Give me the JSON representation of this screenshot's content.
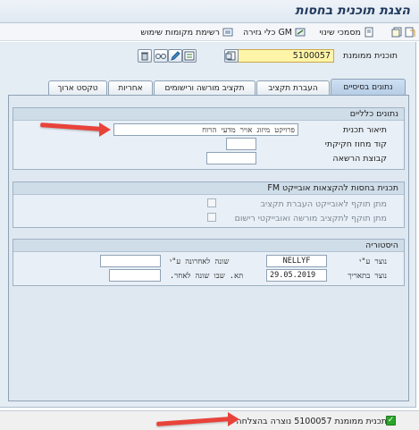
{
  "window": {
    "title": "הצגת תוכנית בחסות"
  },
  "toolbar": {
    "where_used_list": "רשימת מקומות שימוש",
    "gm_derivation_tools": "GM כלי גזירה",
    "usage_docs": "מסמכי שינוי"
  },
  "header": {
    "budget_label": "תוכנית ממומנת",
    "budget_value": "5100057"
  },
  "tabs": [
    {
      "label": "נתונים בסיסיים",
      "active": true
    },
    {
      "label": "העברת תקציב",
      "active": false
    },
    {
      "label": "תקציב מורשה ורישומים",
      "active": false
    },
    {
      "label": "אחריות",
      "active": false
    },
    {
      "label": "טקסט ארוך",
      "active": false
    }
  ],
  "general_data": {
    "title": "נתונים כלליים",
    "description_label": "תיאור תכנית",
    "description_value": "פרויקט מיזוג אויר מדעי הרוח",
    "funding_code_label": "קוד מחוז חקיקתי",
    "funding_code_value": "",
    "auth_group_label": "קבוצת הרשאה",
    "auth_group_value": ""
  },
  "fm_assignment": {
    "title": "תכנית בחסות להקצאות אובייקט FM",
    "transfer_object_label": "מתן תוקף לאובייקט העברת תקציב",
    "posting_object_label": "מתן תוקף לתקציב מורשה ואובייקטי רישום",
    "transfer_object_checked": false,
    "posting_object_checked": false
  },
  "history": {
    "title": "היסטוריה",
    "created_by_label": "נוצר ע\"י",
    "created_by_value": "NELLYF",
    "created_on_label": "נוצר בתאריך",
    "created_on_value": "29.05.2019",
    "changed_by_label": "שונה לאחרונה ע\"י",
    "changed_by_value": "",
    "changed_on_label": "תא. שבו שונה לאחר.",
    "changed_on_value": ""
  },
  "status": {
    "message": "תכנית ממומנת 5100057 נוצרה בהצלחה",
    "type": "success"
  },
  "colors": {
    "accent": "#e8433a",
    "tab_active": "#b5cde6",
    "required_field": "#fff5a8",
    "success": "#2aa52a"
  }
}
